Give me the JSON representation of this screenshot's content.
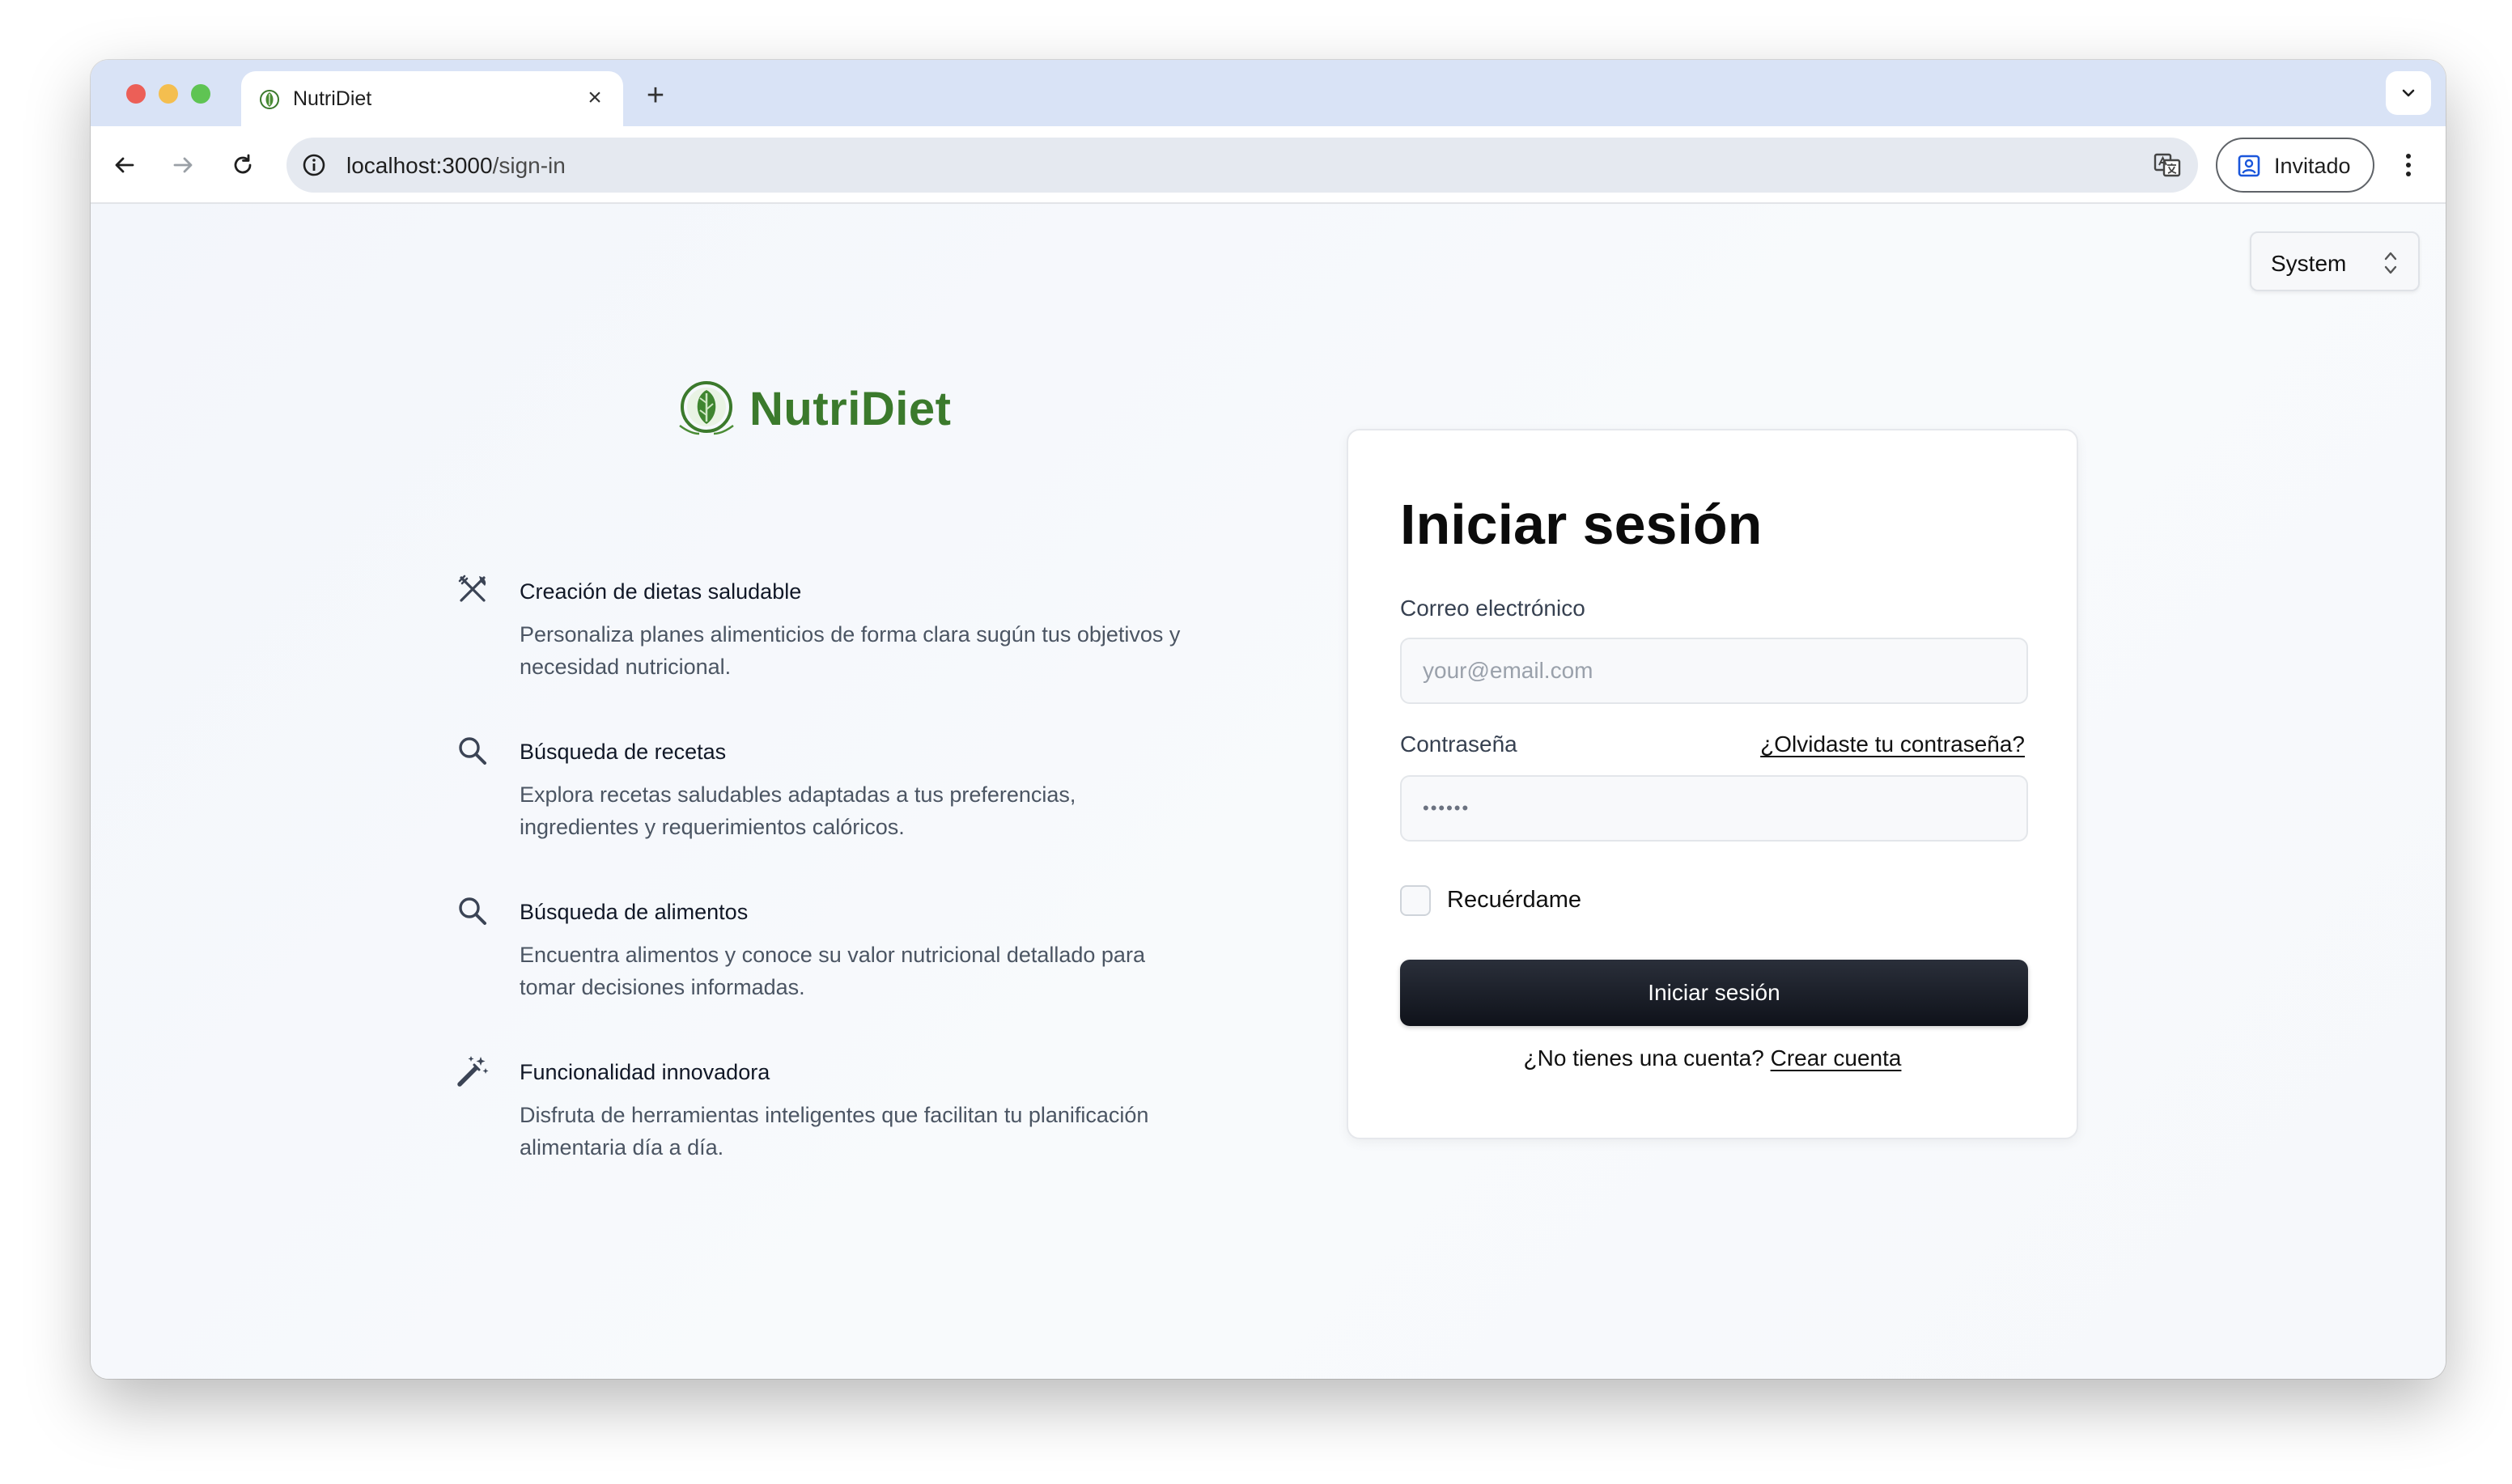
{
  "browser": {
    "tab_title": "NutriDiet",
    "tab_close": "×",
    "new_tab": "+",
    "url_host": "localhost:3000",
    "url_path": "/sign-in",
    "profile_label": "Invitado"
  },
  "page": {
    "theme_select": {
      "selected": "System"
    },
    "brand": {
      "name": "NutriDiet",
      "color": "#3b7a2c"
    },
    "features": [
      {
        "icon": "fork-knife-icon",
        "title": "Creación de dietas saludable",
        "description": "Personaliza planes alimenticios de forma clara sugún tus objetivos y necesidad nutricional."
      },
      {
        "icon": "search-icon",
        "title": "Búsqueda de recetas",
        "description": "Explora recetas saludables adaptadas a tus preferencias, ingredientes y requerimientos calóricos."
      },
      {
        "icon": "search-icon",
        "title": "Búsqueda de alimentos",
        "description": "Encuentra alimentos y conoce su valor nutricional detallado para tomar decisiones informadas."
      },
      {
        "icon": "magic-wand-icon",
        "title": "Funcionalidad innovadora",
        "description": "Disfruta de herramientas inteligentes que facilitan tu planificación alimentaria día a día."
      }
    ],
    "sign_in": {
      "title": "Iniciar sesión",
      "email_label": "Correo electrónico",
      "email_placeholder": "your@email.com",
      "password_label": "Contraseña",
      "forgot_password": "¿Olvidaste tu contraseña?",
      "password_value": "••••••",
      "remember_me": "Recuérdame",
      "remember_checked": false,
      "submit": "Iniciar sesión",
      "no_account": "¿No tienes una cuenta?",
      "create_account": "Crear cuenta",
      "button_color": "#111827"
    }
  }
}
